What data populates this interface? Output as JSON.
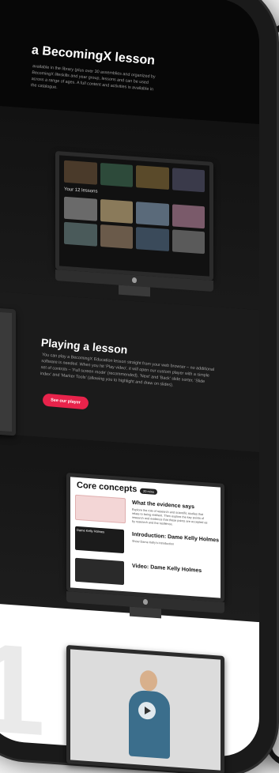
{
  "section_lesson": {
    "title": "a BecomingX lesson",
    "text": "available in the library (plus over 30 assemblies and organized by BecomingX lifeskills and year group, lessons and can be used across a range of ages. A full content and activities is available in the catalogue."
  },
  "library_monitor": {
    "row_label": "Your 12 lessons"
  },
  "section_playing": {
    "title": "Playing a lesson",
    "text": "You can play a BecomingX Education lesson straight from your web browser – no additional software is needed. When you hit 'Play video', it will open our custom player with a simple set of controls – 'Full screen mode' (recommended), 'Next' and 'Back' slide sorter, 'Slide index' and 'Marker Tools' (allowing you to highlight and draw on slides).",
    "button": "See our player"
  },
  "core_concepts": {
    "title": "Core concepts",
    "badge": "20 mins",
    "items": [
      {
        "heading": "What the evidence says",
        "text": "Explore the role of research and scientific studies that relate to being resilient. Then explore the key points of research and evidence that these points are accepted as by research and the resilience."
      },
      {
        "heading": "Introduction: Dame Kelly Holmes",
        "text": "Show Dame Kelly's introduction"
      },
      {
        "heading": "Video: Dame Kelly Holmes",
        "text": ""
      }
    ],
    "card_label": "Dame Kelly Holmes"
  },
  "colors": {
    "accent": "#e8234b",
    "background": "#0e0e0e"
  }
}
